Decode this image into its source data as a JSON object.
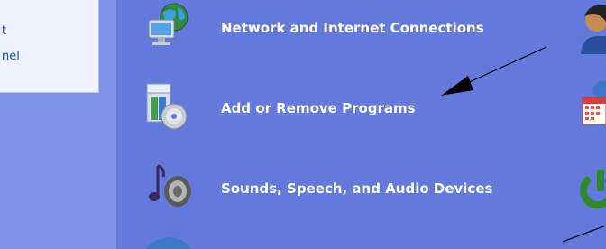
{
  "sidebar": {
    "links": [
      {
        "label": "t"
      },
      {
        "label": "nel"
      }
    ]
  },
  "categories": [
    {
      "label": "Network and Internet Connections",
      "icon": "network-globe-icon"
    },
    {
      "label": "Add or Remove Programs",
      "icon": "install-cd-box-icon"
    },
    {
      "label": "Sounds, Speech, and Audio Devices",
      "icon": "speaker-note-icon"
    }
  ],
  "right_edge_icons": [
    "user-accounts-icon",
    "date-time-calendar-icon",
    "power-options-icon"
  ],
  "colors": {
    "main_bg": "#6379dc",
    "sidebar_bg": "#7d92e4",
    "sidebar_box": "#eef2fc",
    "link": "#1848c4",
    "label": "#ffffff",
    "arrow": "#000000"
  }
}
